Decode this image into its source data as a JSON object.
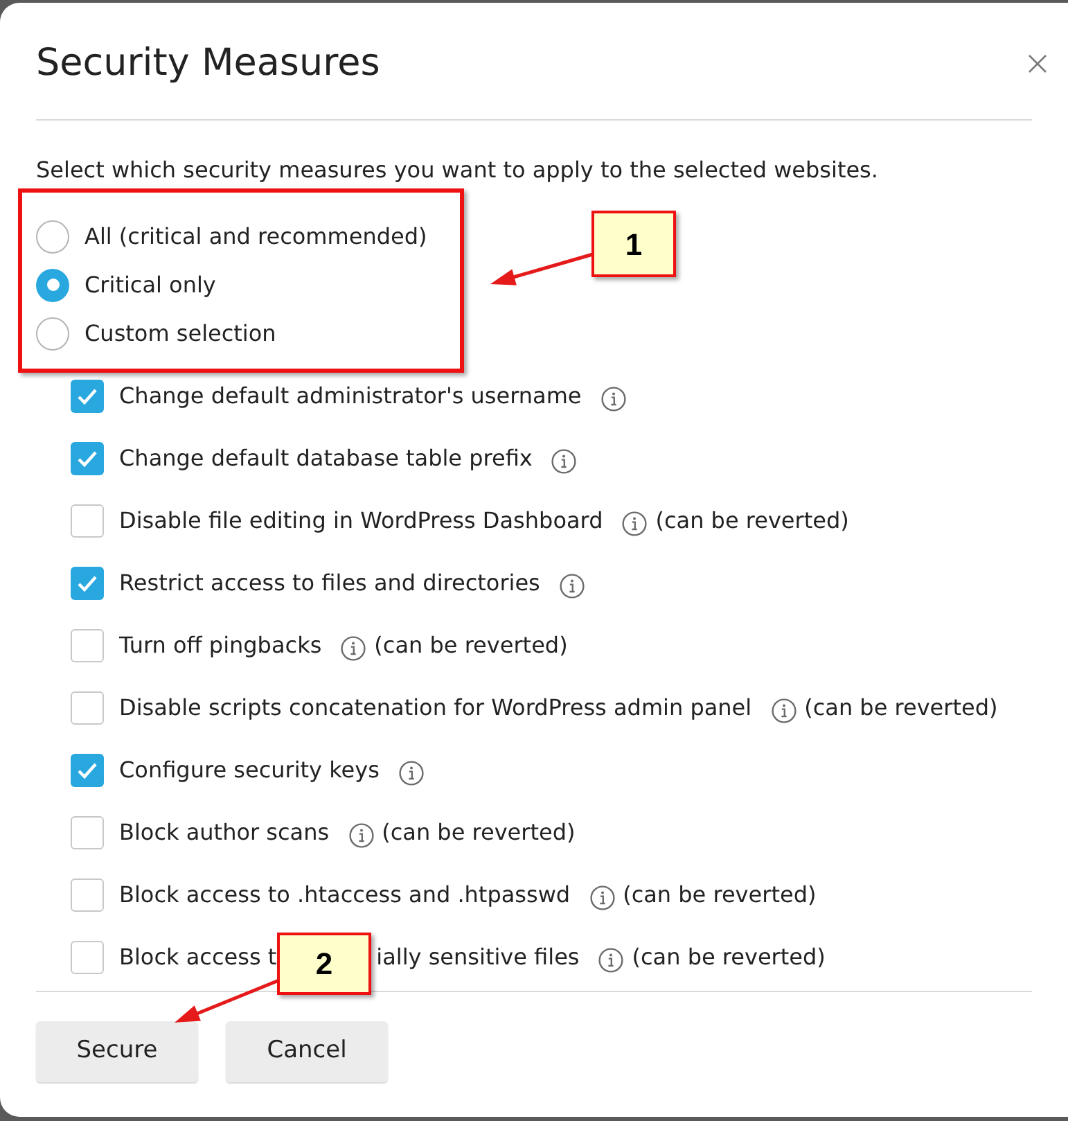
{
  "dialog": {
    "title": "Security Measures",
    "description": "Select which security measures you want to apply to the selected websites."
  },
  "modes": [
    {
      "label": "All (critical and recommended)",
      "selected": false
    },
    {
      "label": "Critical only",
      "selected": true
    },
    {
      "label": "Custom selection",
      "selected": false
    }
  ],
  "measures": [
    {
      "label": "Change default administrator's username",
      "checked": true
    },
    {
      "label": "Change default database table prefix",
      "checked": true
    },
    {
      "label": "Disable file editing in WordPress Dashboard",
      "checked": false,
      "note": "(can be reverted)"
    },
    {
      "label": "Restrict access to files and directories",
      "checked": true
    },
    {
      "label": "Turn off pingbacks",
      "checked": false,
      "note": "(can be reverted)"
    },
    {
      "label": "Disable scripts concatenation for WordPress admin panel",
      "checked": false,
      "note": "(can be reverted)"
    },
    {
      "label": "Configure security keys",
      "checked": true
    },
    {
      "label": "Block author scans",
      "checked": false,
      "note": "(can be reverted)"
    },
    {
      "label": "Block access to .htaccess and .htpasswd",
      "checked": false,
      "note": "(can be reverted)"
    },
    {
      "label": "Block access t",
      "label_rest": "ially sensitive files",
      "checked": false,
      "note": "(can be reverted)"
    }
  ],
  "buttons": [
    "Secure",
    "Cancel"
  ],
  "annotations": [
    {
      "number": "1"
    },
    {
      "number": "2"
    }
  ]
}
